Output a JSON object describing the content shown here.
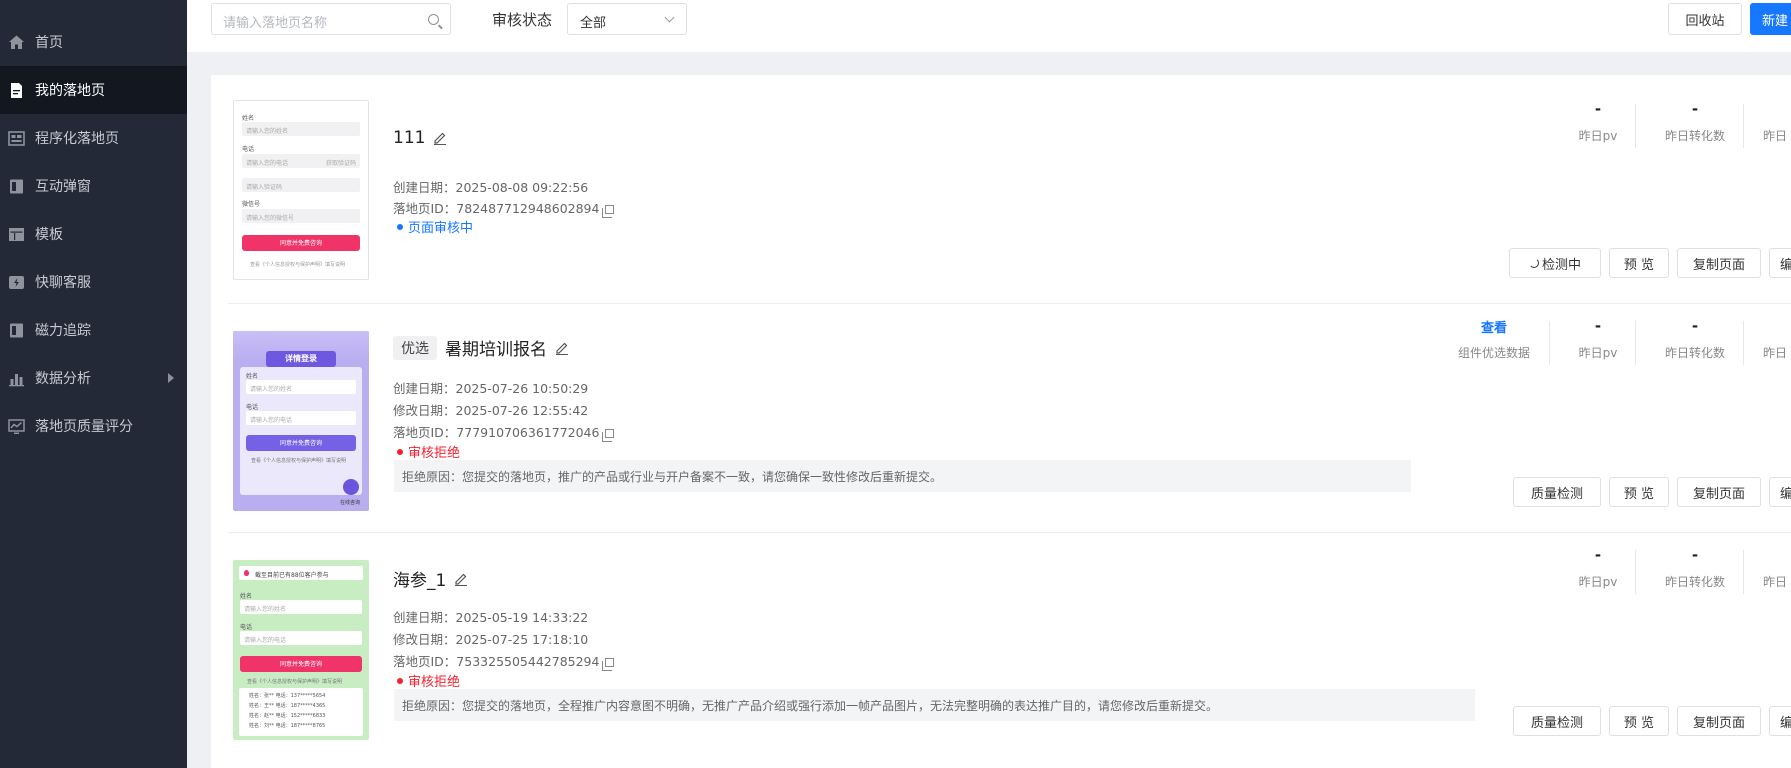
{
  "sidebar": {
    "items": [
      {
        "label": "首页",
        "icon": "home-icon"
      },
      {
        "label": "我的落地页",
        "icon": "document-icon"
      },
      {
        "label": "程序化落地页",
        "icon": "layout-icon"
      },
      {
        "label": "互动弹窗",
        "icon": "popup-icon"
      },
      {
        "label": "模板",
        "icon": "template-icon"
      },
      {
        "label": "快聊客服",
        "icon": "lightning-chat-icon"
      },
      {
        "label": "磁力追踪",
        "icon": "tracking-icon"
      },
      {
        "label": "数据分析",
        "icon": "bar-chart-icon"
      },
      {
        "label": "落地页质量评分",
        "icon": "monitor-chart-icon"
      }
    ]
  },
  "toolbar": {
    "search_placeholder": "请输入落地页名称",
    "status_label": "审核状态",
    "status_value": "全部",
    "recycle_label": "回收站",
    "new_label": "新建"
  },
  "colors": {
    "accent": "#1677ff",
    "sidebar_bg": "#232936",
    "reject": "#f5222d",
    "pending": "#1677ff"
  },
  "rows": [
    {
      "title": "111",
      "created": "创建日期：2025-08-08 09:22:56",
      "id_text": "落地页ID：782487712948602894",
      "status": "页面审核中",
      "stats": [
        {
          "value": "-",
          "label": "昨日pv"
        },
        {
          "value": "-",
          "label": "昨日转化数"
        },
        {
          "value": "",
          "label": "昨日"
        }
      ],
      "actions": [
        "检测中",
        "预 览",
        "复制页面",
        "编"
      ],
      "thumb": {
        "labels": [
          "姓名",
          "电话",
          "微信号"
        ],
        "inputs": [
          "请输入您的姓名",
          "请输入您的电话",
          "获取验证码",
          "请输入验证码",
          "请输入您的微信号"
        ],
        "button": "同意并免费咨询",
        "footer": "查看《个人信息授权与保护声明》填写说明"
      }
    },
    {
      "tag": "优选",
      "title": "暑期培训报名",
      "created": "创建日期：2025-07-26 10:50:29",
      "modified": "修改日期：2025-07-26 12:55:42",
      "id_text": "落地页ID：777910706361772046",
      "status": "审核拒绝",
      "reason": "拒绝原因：您提交的落地页，推广的产品或行业与开户备案不一致，请您确保一致性修改后重新提交。",
      "view_label": "查看",
      "view_sub": "组件优选数据",
      "stats": [
        {
          "value": "-",
          "label": "昨日pv"
        },
        {
          "value": "-",
          "label": "昨日转化数"
        },
        {
          "value": "",
          "label": "昨日"
        }
      ],
      "actions": [
        "质量检测",
        "预 览",
        "复制页面",
        "编"
      ],
      "thumb": {
        "banner": "详情登录",
        "labels": [
          "姓名",
          "电话"
        ],
        "inputs": [
          "请输入您的姓名",
          "请输入您的电话"
        ],
        "button": "同意并免费咨询",
        "footer": "查看《个人信息授权与保护声明》填写说明",
        "consult": "在线咨询"
      }
    },
    {
      "title": "海参_1",
      "created": "创建日期：2025-05-19 14:33:22",
      "modified": "修改日期：2025-07-25 17:18:10",
      "id_text": "落地页ID：753325505442785294",
      "status": "审核拒绝",
      "reason": "拒绝原因：您提交的落地页，全程推广内容意图不明确，无推广产品介绍或强行添加一帧产品图片，无法完整明确的表达推广目的，请您修改后重新提交。",
      "stats": [
        {
          "value": "-",
          "label": "昨日pv"
        },
        {
          "value": "-",
          "label": "昨日转化数"
        },
        {
          "value": "",
          "label": "昨日"
        }
      ],
      "actions": [
        "质量检测",
        "预 览",
        "复制页面",
        "编"
      ],
      "thumb": {
        "notice": "截至目前已有88位客户参与",
        "labels": [
          "姓名",
          "电话"
        ],
        "inputs": [
          "请输入您的姓名",
          "请输入您的电话"
        ],
        "button": "同意并免费咨询",
        "footer": "查看《个人信息授权与保护声明》填写说明",
        "list": [
          "姓名：张**  电话：137*****5654",
          "姓名：王**  电话：187*****4365",
          "姓名：赵**  电话：152*****6833",
          "姓名：刘**  电话：187*****8765"
        ]
      }
    }
  ]
}
